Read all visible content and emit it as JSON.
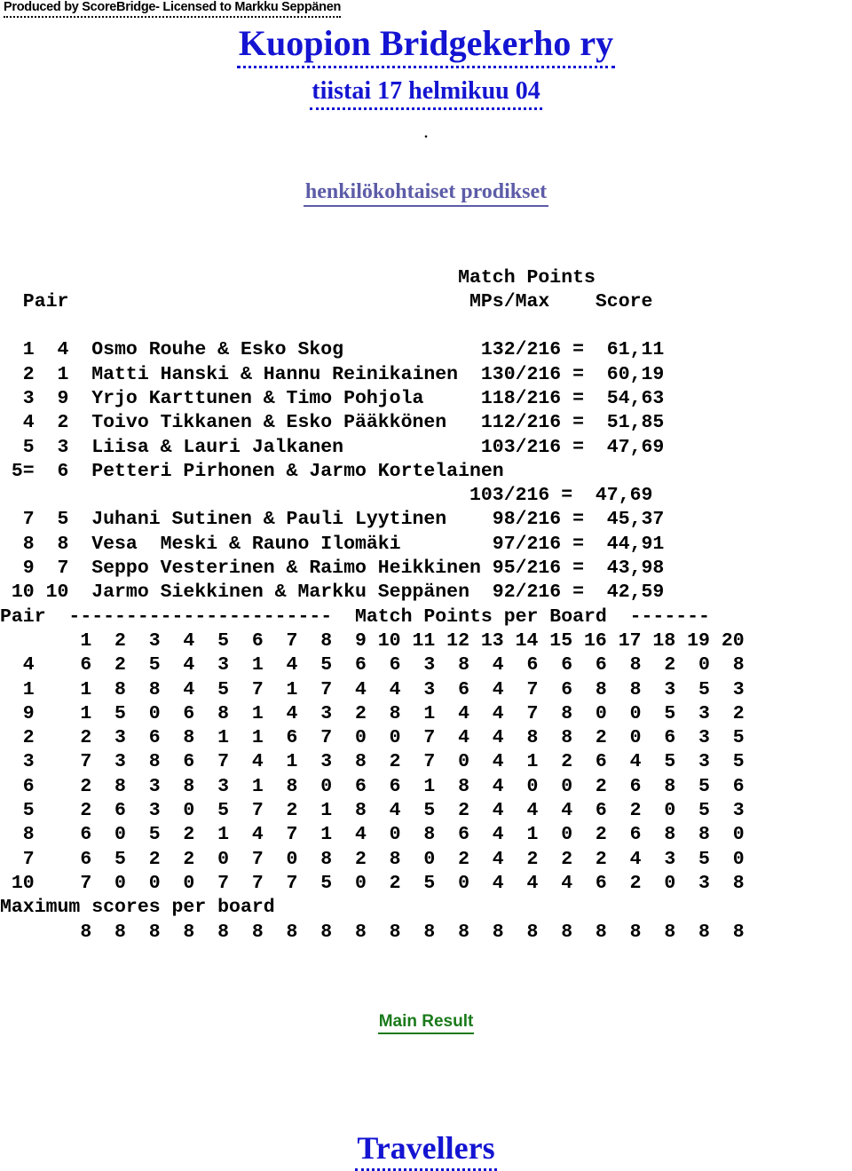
{
  "banner": {
    "produced_by": "Produced by ScoreBridge- Licensed to Markku Seppänen"
  },
  "header": {
    "club_title": "Kuopion Bridgekerho ry",
    "date_title": "tiistai 17 helmikuu 04",
    "dot": ".",
    "section_link": "henkilökohtaiset prodikset"
  },
  "ranking": {
    "col_header_top": "Match Points",
    "col_header_pair": "Pair",
    "col_header_mps": "MPs/Max",
    "col_header_score": "Score",
    "rows": [
      {
        "rank": "1",
        "pair": "4",
        "names": "Osmo Rouhe & Esko Skog",
        "mps": "132/216",
        "eq": "=",
        "pct": "61,11"
      },
      {
        "rank": "2",
        "pair": "1",
        "names": "Matti Hanski & Hannu Reinikainen",
        "mps": "130/216",
        "eq": "=",
        "pct": "60,19"
      },
      {
        "rank": "3",
        "pair": "9",
        "names": "Yrjo Karttunen & Timo Pohjola",
        "mps": "118/216",
        "eq": "=",
        "pct": "54,63"
      },
      {
        "rank": "4",
        "pair": "2",
        "names": "Toivo Tikkanen & Esko Pääkkönen",
        "mps": "112/216",
        "eq": "=",
        "pct": "51,85"
      },
      {
        "rank": "5",
        "pair": "3",
        "names": "Liisa & Lauri Jalkanen",
        "mps": "103/216",
        "eq": "=",
        "pct": "47,69"
      },
      {
        "rank": "5=",
        "pair": "6",
        "names": "Petteri Pirhonen & Jarmo Kortelainen",
        "mps": "103/216",
        "eq": "=",
        "pct": "47,69"
      },
      {
        "rank": "7",
        "pair": "5",
        "names": "Juhani Sutinen & Pauli Lyytinen",
        "mps": "98/216",
        "eq": "=",
        "pct": "45,37"
      },
      {
        "rank": "8",
        "pair": "8",
        "names": "Vesa  Meski & Rauno Ilomäki",
        "mps": "97/216",
        "eq": "=",
        "pct": "44,91"
      },
      {
        "rank": "9",
        "pair": "7",
        "names": "Seppo Vesterinen & Raimo Heikkinen",
        "mps": "95/216",
        "eq": "=",
        "pct": "43,98"
      },
      {
        "rank": "10",
        "pair": "10",
        "names": "Jarmo Siekkinen & Markku Seppänen",
        "mps": "92/216",
        "eq": "=",
        "pct": "42,59"
      }
    ]
  },
  "board_grid": {
    "title_left": "Pair",
    "title_dashes_left": "-----------------------",
    "title_text": "Match Points per Board",
    "title_dashes_right": "-------",
    "board_numbers": [
      "1",
      "2",
      "3",
      "4",
      "5",
      "6",
      "7",
      "8",
      "9",
      "10",
      "11",
      "12",
      "13",
      "14",
      "15",
      "16",
      "17",
      "18",
      "19",
      "20"
    ],
    "maximum_label": "Maximum scores per board",
    "rows": [
      {
        "pair": "4",
        "scores": [
          6,
          2,
          5,
          4,
          3,
          1,
          4,
          5,
          6,
          6,
          3,
          8,
          4,
          6,
          6,
          6,
          8,
          2,
          0,
          8
        ]
      },
      {
        "pair": "1",
        "scores": [
          1,
          8,
          8,
          4,
          5,
          7,
          1,
          7,
          4,
          4,
          3,
          6,
          4,
          7,
          6,
          8,
          8,
          3,
          5,
          3
        ]
      },
      {
        "pair": "9",
        "scores": [
          1,
          5,
          0,
          6,
          8,
          1,
          4,
          3,
          2,
          8,
          1,
          4,
          4,
          7,
          8,
          0,
          0,
          5,
          3,
          2
        ]
      },
      {
        "pair": "2",
        "scores": [
          2,
          3,
          6,
          8,
          1,
          1,
          6,
          7,
          0,
          0,
          7,
          4,
          4,
          8,
          8,
          2,
          0,
          6,
          3,
          5
        ]
      },
      {
        "pair": "3",
        "scores": [
          7,
          3,
          8,
          6,
          7,
          4,
          1,
          3,
          8,
          2,
          7,
          0,
          4,
          1,
          2,
          6,
          4,
          5,
          3,
          5
        ]
      },
      {
        "pair": "6",
        "scores": [
          2,
          8,
          3,
          8,
          3,
          1,
          8,
          0,
          6,
          6,
          1,
          8,
          4,
          0,
          0,
          2,
          6,
          8,
          5,
          6
        ]
      },
      {
        "pair": "5",
        "scores": [
          2,
          6,
          3,
          0,
          5,
          7,
          2,
          1,
          8,
          4,
          5,
          2,
          4,
          4,
          4,
          6,
          2,
          0,
          5,
          3
        ]
      },
      {
        "pair": "8",
        "scores": [
          6,
          0,
          5,
          2,
          1,
          4,
          7,
          1,
          4,
          0,
          8,
          6,
          4,
          1,
          0,
          2,
          6,
          8,
          8,
          0
        ]
      },
      {
        "pair": "7",
        "scores": [
          6,
          5,
          2,
          2,
          0,
          7,
          0,
          8,
          2,
          8,
          0,
          2,
          4,
          2,
          2,
          2,
          4,
          3,
          5,
          0
        ]
      },
      {
        "pair": "10",
        "scores": [
          7,
          0,
          0,
          0,
          7,
          7,
          7,
          5,
          0,
          2,
          5,
          0,
          4,
          4,
          4,
          6,
          2,
          0,
          3,
          8
        ]
      }
    ],
    "maximum_scores": [
      8,
      8,
      8,
      8,
      8,
      8,
      8,
      8,
      8,
      8,
      8,
      8,
      8,
      8,
      8,
      8,
      8,
      8,
      8,
      8
    ]
  },
  "footer": {
    "main_result": "Main Result",
    "travellers": "Travellers"
  },
  "colors": {
    "title_blue": "#1414d2",
    "section_purple": "#5c5ca8",
    "link_green": "#1a7a1a",
    "text_black": "#000000",
    "background": "#ffffff"
  }
}
